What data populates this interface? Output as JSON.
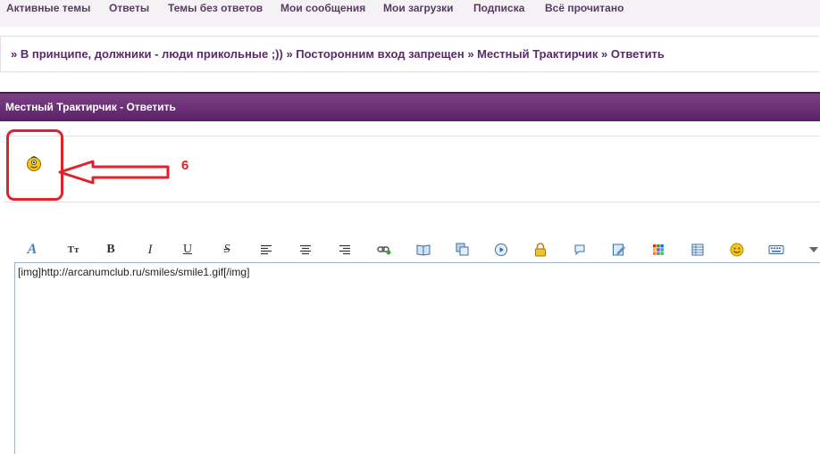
{
  "nav": {
    "items": [
      {
        "label": "Активные темы"
      },
      {
        "label": "Ответы"
      },
      {
        "label": "Темы без ответов"
      },
      {
        "label": "Мои сообщения"
      },
      {
        "label": "Мои загрузки"
      },
      {
        "label": "Подписка"
      },
      {
        "label": "Всё прочитано"
      }
    ]
  },
  "breadcrumb": {
    "items": [
      "» В принципе, должники - люди прикольные ;))",
      "» Посторонним вход запрещен",
      "» Местный Трактирчик",
      "» Ответить"
    ]
  },
  "panel": {
    "title": "Местный Трактирчик - Ответить"
  },
  "annotation": {
    "label": "6",
    "color": "#e0222a"
  },
  "toolbar": {
    "buttons": [
      {
        "icon": "font-color-icon"
      },
      {
        "icon": "font-size-icon",
        "glyph": "Tт"
      },
      {
        "icon": "bold-icon",
        "glyph": "B"
      },
      {
        "icon": "italic-icon",
        "glyph": "I"
      },
      {
        "icon": "underline-icon",
        "glyph": "U"
      },
      {
        "icon": "strikethrough-icon",
        "glyph": "S"
      },
      {
        "icon": "align-left-icon"
      },
      {
        "icon": "align-center-icon"
      },
      {
        "icon": "align-right-icon"
      },
      {
        "icon": "link-icon"
      },
      {
        "icon": "book-icon"
      },
      {
        "icon": "copy-icon"
      },
      {
        "icon": "play-icon"
      },
      {
        "icon": "lock-icon"
      },
      {
        "icon": "speech-bubble-icon"
      },
      {
        "icon": "edit-icon"
      },
      {
        "icon": "color-grid-icon"
      },
      {
        "icon": "table-icon"
      },
      {
        "icon": "smiley-icon"
      },
      {
        "icon": "keyboard-icon"
      },
      {
        "icon": "dropdown-arrow-icon"
      }
    ]
  },
  "editor": {
    "value": "[img]http://arcanumclub.ru/smiles/smile1.gif[/img]"
  }
}
